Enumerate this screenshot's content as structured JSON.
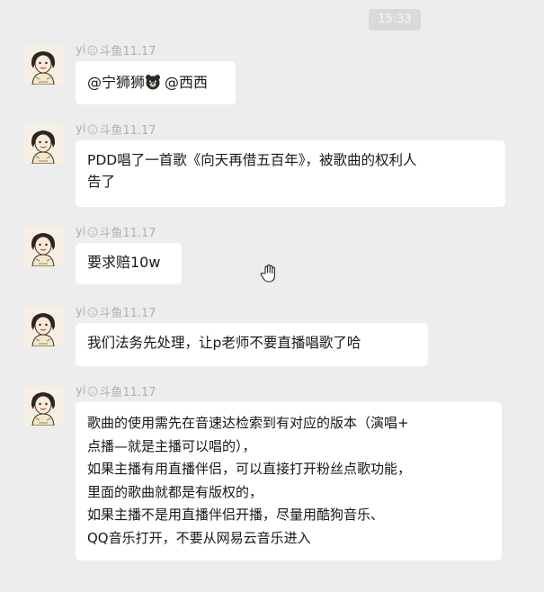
{
  "time": "15:33",
  "sender_prefix": "yi",
  "sender_suffix": "斗鱼11.17",
  "messages": [
    {
      "parts": [
        "@宁狮狮",
        "@西西"
      ]
    },
    {
      "lines": [
        "PDD唱了一首歌《向天再借五百年》，被歌曲的权利人",
        "告了"
      ]
    },
    {
      "lines": [
        "要求赔10w"
      ]
    },
    {
      "lines": [
        "我们法务先处理，让p老师不要直播唱歌了哈"
      ]
    },
    {
      "lines": [
        "歌曲的使用需先在音速达检索到有对应的版本（演唱+",
        "点播—就是主播可以唱的），",
        "如果主播有用直播伴侣，可以直接打开粉丝点歌功能，",
        "里面的歌曲就都是有版权的，",
        "如果主播不是用直播伴侣开播，尽量用酷狗音乐、",
        "QQ音乐打开，不要从网易云音乐进入"
      ]
    }
  ],
  "icons": {
    "avatar": "cartoon-girl-avatar-icon",
    "sender_badge": "smiley-face-icon",
    "emoji": "bear-face-icon",
    "cursor": "hand-pointer-icon"
  }
}
